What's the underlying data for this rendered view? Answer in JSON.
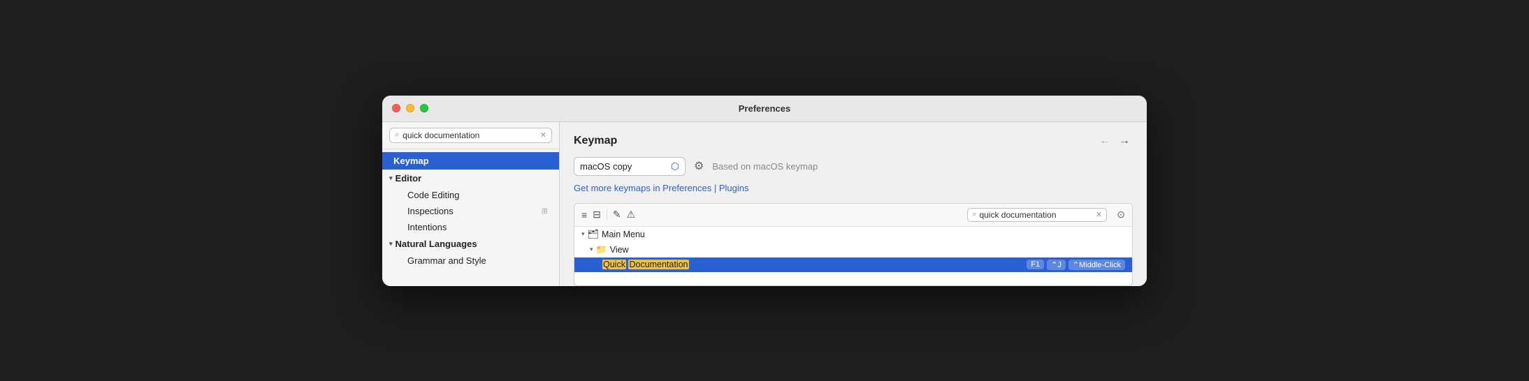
{
  "window": {
    "title": "Preferences"
  },
  "sidebar": {
    "search_placeholder": "quick documentation",
    "search_value": "quick documentation",
    "selected_item": "Keymap",
    "items": [
      {
        "label": "Keymap",
        "type": "selected"
      },
      {
        "label": "Editor",
        "type": "section",
        "expanded": true
      },
      {
        "label": "Code Editing",
        "type": "child",
        "level": 1,
        "has_icon": false
      },
      {
        "label": "Inspections",
        "type": "child",
        "level": 1,
        "has_icon": true
      },
      {
        "label": "Intentions",
        "type": "child",
        "level": 1,
        "has_icon": false
      },
      {
        "label": "Natural Languages",
        "type": "section",
        "expanded": true
      },
      {
        "label": "Grammar and Style",
        "type": "child",
        "level": 1,
        "has_icon": false
      }
    ]
  },
  "main": {
    "title": "Keymap",
    "keymap_name": "macOS copy",
    "based_on": "Based on macOS keymap",
    "get_more_link": "Get more keymaps in Preferences | Plugins",
    "search_value": "quick documentation",
    "tree": {
      "rows": [
        {
          "level": 0,
          "label": "Main Menu",
          "expanded": true,
          "icon": "📋",
          "type": "group"
        },
        {
          "level": 1,
          "label": "View",
          "expanded": true,
          "icon": "📁",
          "type": "group"
        },
        {
          "level": 2,
          "label": "Quick Documentation",
          "selected": true,
          "shortcuts": [
            "F1",
            "⌃J",
            "⌃Middle-Click"
          ],
          "highlight": [
            "Quick",
            "Documentation"
          ]
        }
      ]
    }
  },
  "icons": {
    "search": "🔍",
    "gear": "⚙",
    "filter_all": "≡",
    "filter_some": "⊟",
    "edit": "✏",
    "warning": "⚠",
    "person": "👤",
    "back_arrow": "←",
    "forward_arrow": "→"
  }
}
